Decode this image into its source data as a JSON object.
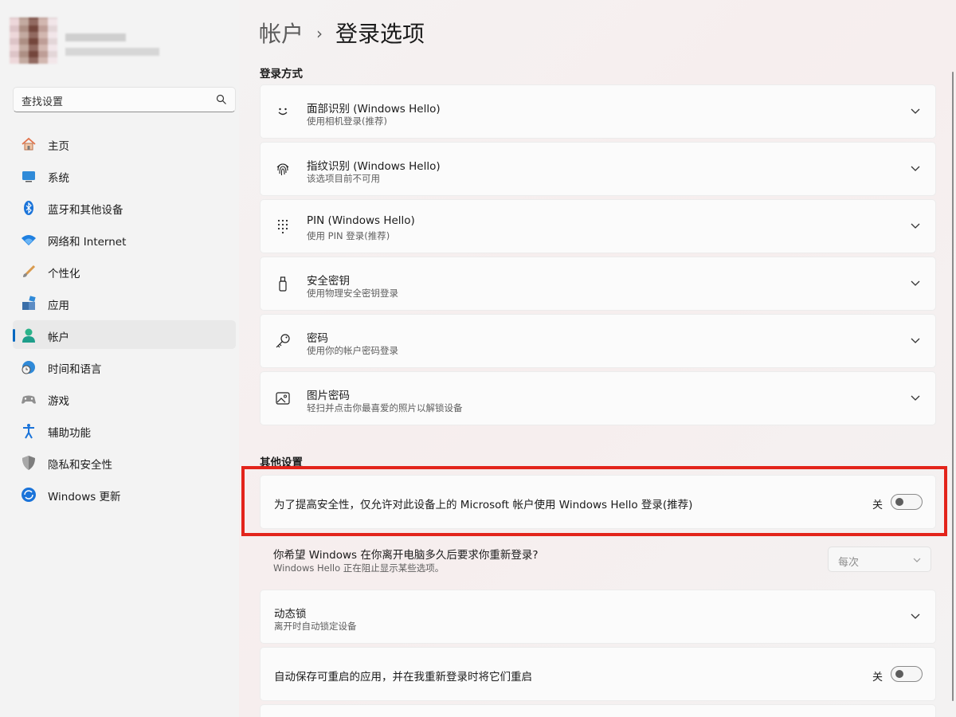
{
  "breadcrumb": {
    "parent": "帐户",
    "separator": "›",
    "current": "登录选项"
  },
  "search": {
    "placeholder": "查找设置"
  },
  "nav": [
    {
      "label": "主页",
      "icon": "home-icon"
    },
    {
      "label": "系统",
      "icon": "system-icon"
    },
    {
      "label": "蓝牙和其他设备",
      "icon": "bluetooth-icon"
    },
    {
      "label": "网络和 Internet",
      "icon": "wifi-icon"
    },
    {
      "label": "个性化",
      "icon": "brush-icon"
    },
    {
      "label": "应用",
      "icon": "apps-icon"
    },
    {
      "label": "帐户",
      "icon": "account-icon",
      "active": true
    },
    {
      "label": "时间和语言",
      "icon": "globe-clock-icon"
    },
    {
      "label": "游戏",
      "icon": "gamepad-icon"
    },
    {
      "label": "辅助功能",
      "icon": "accessibility-icon"
    },
    {
      "label": "隐私和安全性",
      "icon": "shield-icon"
    },
    {
      "label": "Windows 更新",
      "icon": "update-icon"
    }
  ],
  "sections": {
    "signin_methods": "登录方式",
    "other_settings": "其他设置"
  },
  "signin_methods": [
    {
      "title": "面部识别 (Windows Hello)",
      "subtitle": "使用相机登录(推荐)",
      "icon": "face-icon"
    },
    {
      "title": "指纹识别 (Windows Hello)",
      "subtitle": "该选项目前不可用",
      "icon": "fingerprint-icon"
    },
    {
      "title": "PIN (Windows Hello)",
      "subtitle": "使用 PIN 登录(推荐)",
      "icon": "pin-keypad-icon"
    },
    {
      "title": "安全密钥",
      "subtitle": "使用物理安全密钥登录",
      "icon": "usb-key-icon"
    },
    {
      "title": "密码",
      "subtitle": "使用你的帐户密码登录",
      "icon": "key-icon"
    },
    {
      "title": "图片密码",
      "subtitle": "轻扫并点击你最喜爱的照片以解锁设备",
      "icon": "picture-icon"
    }
  ],
  "other": {
    "hello_only": {
      "title": "为了提高安全性，仅允许对此设备上的 Microsoft 帐户使用 Windows Hello 登录(推荐)",
      "state": "关"
    },
    "require_signin": {
      "title": "你希望 Windows 在你离开电脑多久后要求你重新登录?",
      "subtitle": "Windows Hello 正在阻止显示某些选项。",
      "value": "每次"
    },
    "dynamic_lock": {
      "title": "动态锁",
      "subtitle": "离开时自动锁定设备"
    },
    "restart_apps": {
      "title": "自动保存可重启的应用，并在我重新登录时将它们重启",
      "state": "关"
    }
  },
  "colors": {
    "accent": "#0067c0",
    "highlight": "#e3241b"
  }
}
